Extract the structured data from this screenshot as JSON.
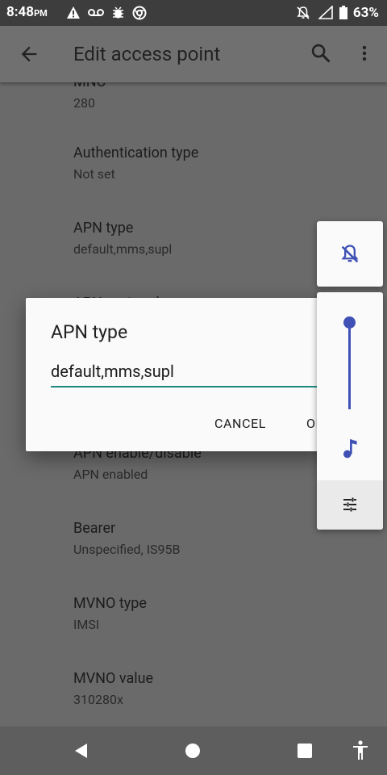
{
  "status": {
    "time": "8:48",
    "ampm": "PM",
    "battery": "63%"
  },
  "app_bar": {
    "title": "Edit access point"
  },
  "prefs": [
    {
      "title": "MNC",
      "summary": "280"
    },
    {
      "title": "Authentication type",
      "summary": "Not set"
    },
    {
      "title": "APN type",
      "summary": "default,mms,supl"
    },
    {
      "title": "APN protocol",
      "summary": ""
    },
    {
      "title": "APN enable/disable",
      "summary": "APN enabled"
    },
    {
      "title": "Bearer",
      "summary": "Unspecified, IS95B"
    },
    {
      "title": "MVNO type",
      "summary": "IMSI"
    },
    {
      "title": "MVNO value",
      "summary": "310280x"
    }
  ],
  "dialog": {
    "title": "APN type",
    "value": "default,mms,supl",
    "cancel": "CANCEL",
    "ok": "OK"
  },
  "colors": {
    "accent": "#1e8a7e",
    "volume": "#3f51b5",
    "scrim": "#6a6a6a"
  },
  "volume_panel": {
    "level": 1.0
  }
}
